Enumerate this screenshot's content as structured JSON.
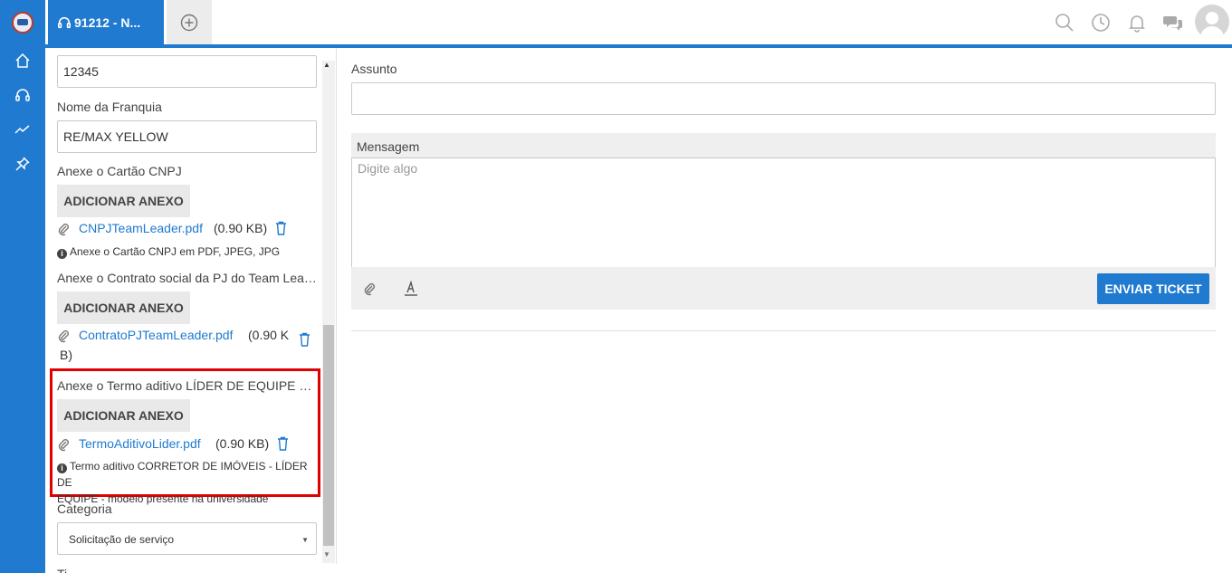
{
  "nav": {
    "items": [
      {
        "icon": "home-icon"
      },
      {
        "icon": "headset-icon"
      },
      {
        "icon": "trend-icon"
      },
      {
        "icon": "pin-icon"
      }
    ]
  },
  "tabs": {
    "active_label": "91212 - N...",
    "add_icon": "plus-circle-icon"
  },
  "topbar": {
    "icons": [
      "search-icon",
      "clock-icon",
      "bell-icon",
      "chat-icon"
    ]
  },
  "form": {
    "first_value": "12345",
    "franquia_label": "Nome da Franquia",
    "franquia_value": "RE/MAX YELLOW",
    "cnpj_label": "Anexe o Cartão CNPJ",
    "cnpj_button": "ADICIONAR ANEXO",
    "cnpj_file": "CNPJTeamLeader.pdf",
    "cnpj_size": "(0.90 KB)",
    "cnpj_hint": "Anexe o Cartão CNPJ em PDF, JPEG, JPG",
    "contrato_label": "Anexe o Contrato social da PJ do Team Leader",
    "contrato_button": "ADICIONAR ANEXO",
    "contrato_file": "ContratoPJTeamLeader.pdf",
    "contrato_size_1": "(0.90 K",
    "contrato_size_2": "B)",
    "termo_label": "Anexe o Termo aditivo LÍDER DE EQUIPE presente na universidade",
    "termo_button": "ADICIONAR ANEXO",
    "termo_file": "TermoAditivoLider.pdf",
    "termo_size": "(0.90 KB)",
    "termo_hint_1": "Termo aditivo CORRETOR DE IMÓVEIS - LÍDER DE",
    "termo_hint_2": "EQUIPE - modelo presente na universidade",
    "categoria_label": "Categoria",
    "categoria_value": "Solicitação de serviço",
    "next_label_partial": "Ti"
  },
  "ticket": {
    "assunto_label": "Assunto",
    "assunto_value": "",
    "mensagem_label": "Mensagem",
    "mensagem_placeholder": "Digite algo",
    "send_button": "ENVIAR TICKET"
  }
}
